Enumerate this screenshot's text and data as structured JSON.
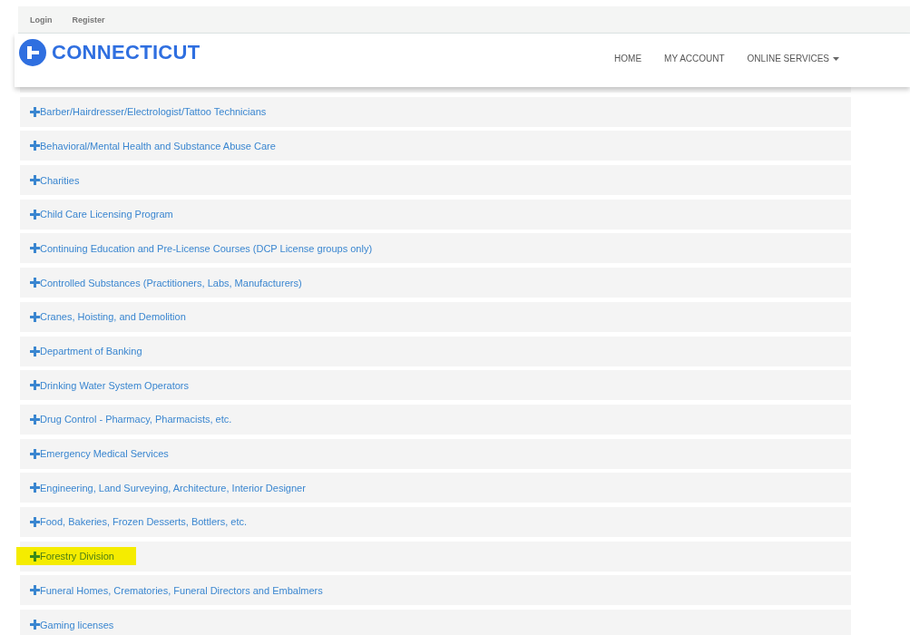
{
  "top_links": [
    "Login",
    "Register"
  ],
  "logo": {
    "text": "CONNECTICUT"
  },
  "nav": [
    {
      "label": "HOME",
      "dropdown": false
    },
    {
      "label": "MY ACCOUNT",
      "dropdown": false
    },
    {
      "label": "ONLINE SERVICES",
      "dropdown": true
    }
  ],
  "panels": [
    {
      "label": "Barber/Hairdresser/Electrologist/Tattoo Technicians",
      "highlighted": false
    },
    {
      "label": "Behavioral/Mental Health and Substance Abuse Care",
      "highlighted": false
    },
    {
      "label": "Charities",
      "highlighted": false
    },
    {
      "label": "Child Care Licensing Program",
      "highlighted": false
    },
    {
      "label": "Continuing Education and Pre-License Courses (DCP License groups only)",
      "highlighted": false
    },
    {
      "label": "Controlled Substances (Practitioners, Labs, Manufacturers)",
      "highlighted": false
    },
    {
      "label": "Cranes, Hoisting, and Demolition",
      "highlighted": false
    },
    {
      "label": "Department of Banking",
      "highlighted": false
    },
    {
      "label": "Drinking Water System Operators",
      "highlighted": false
    },
    {
      "label": "Drug Control - Pharmacy, Pharmacists, etc.",
      "highlighted": false
    },
    {
      "label": "Emergency Medical Services",
      "highlighted": false
    },
    {
      "label": "Engineering, Land Surveying, Architecture, Interior Designer",
      "highlighted": false
    },
    {
      "label": "Food, Bakeries, Frozen Desserts, Bottlers, etc.",
      "highlighted": false
    },
    {
      "label": "Forestry Division",
      "highlighted": true
    },
    {
      "label": "Funeral Homes, Crematories, Funeral Directors and Embalmers",
      "highlighted": false
    },
    {
      "label": "Gaming licenses",
      "highlighted": false
    }
  ]
}
